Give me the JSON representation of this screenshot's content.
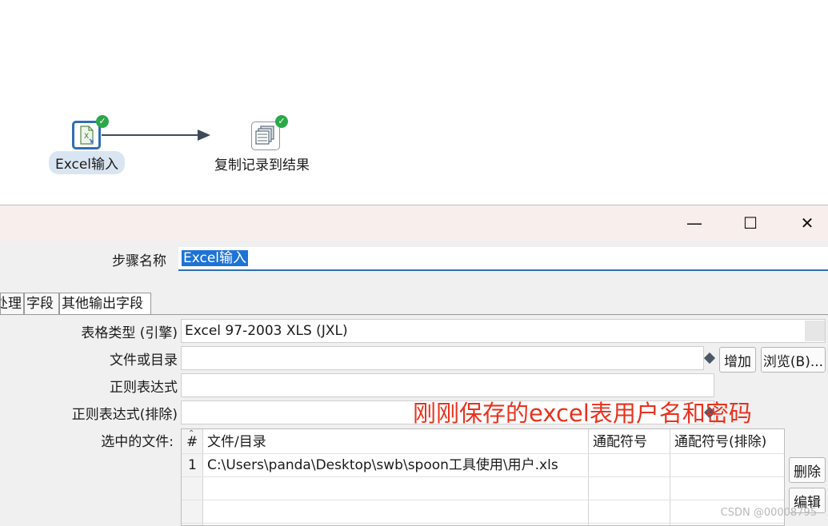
{
  "canvas": {
    "steps": [
      {
        "label": "Excel输入",
        "icon": "excel-file-icon",
        "status_icon": "check-icon"
      },
      {
        "label": "复制记录到结果",
        "icon": "copy-rows-icon",
        "status_icon": "check-icon"
      }
    ]
  },
  "dialog": {
    "window_controls": {
      "minimize": "—",
      "maximize": "☐",
      "close": "✕"
    },
    "step_name_label": "步骤名称",
    "step_name_value": "Excel输入",
    "tabs": [
      "处理",
      "字段",
      "其他输出字段"
    ],
    "form": {
      "sheet_type_label": "表格类型 (引擎)",
      "sheet_type_value": "Excel 97-2003 XLS (JXL)",
      "file_dir_label": "文件或目录",
      "file_dir_value": "",
      "regex_label": "正则表达式",
      "regex_value": "",
      "regex_exclude_label": "正则表达式(排除)",
      "regex_exclude_value": "",
      "selected_files_label": "选中的文件:"
    },
    "buttons": {
      "add": "增加",
      "browse": "浏览(B)...",
      "delete": "删除",
      "edit": "编辑"
    },
    "annotation": "刚刚保存的excel表用户名和密码",
    "files_table": {
      "columns": [
        "#",
        "文件/目录",
        "通配符号",
        "通配符号(排除)"
      ],
      "rows": [
        {
          "num": "1",
          "path": "C:\\Users\\panda\\Desktop\\swb\\spoon工具使用\\用户.xls",
          "wildcard": "",
          "wildcard_exclude": ""
        }
      ]
    }
  },
  "watermark": "CSDN @00008795",
  "colors": {
    "accent": "#2f6fb0",
    "selection": "#1e73d6",
    "ok": "#2aa84a",
    "annotation": "#e8321e",
    "titlebar": "#f8efec"
  }
}
